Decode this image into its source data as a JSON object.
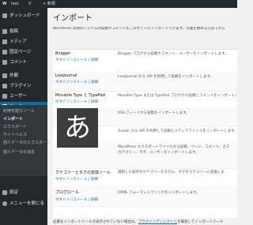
{
  "adminbar": {
    "wp_logo": "W",
    "home": "test",
    "comments": "0",
    "new": "+ 新規"
  },
  "menu": {
    "dashboard": "ダッシュボード",
    "posts": "投稿",
    "media": "メディア",
    "pages": "固定ページ",
    "comments": "コメント",
    "appearance": "外観",
    "plugins": "プラグイン",
    "users": "ユーザー",
    "tools": "ツール",
    "settings": "設定",
    "collapse": "メニューを閉じる",
    "submenu": [
      "利用可能なツール",
      "インポート",
      "エクスポート",
      "サイトヘルス",
      "個人データのエクスポート",
      "個人データの消去"
    ]
  },
  "page": {
    "title": "インポート",
    "intro": "WordPress は他のシステムの投稿やコメントをこのサイトにインポートできます。作業を始めるには下から"
  },
  "importers": [
    {
      "name": "Blogger",
      "action": "今すぐインストール | 詳細",
      "desc": "Blogger ブログから投稿やコメント、ユーザーをインポートします。"
    },
    {
      "name": "LiveJournal",
      "action": "今すぐインストール | 詳細",
      "desc": "LiveJournal から API を利用して投稿をインポートします。"
    },
    {
      "name": "Movable Type と TypePad",
      "action": "今すぐインストール | 詳細",
      "desc": "Movable Type または TypePad ブログから投稿とコメントをインポートします。"
    },
    {
      "name": "RSS",
      "action": "今すぐインストール | 詳細",
      "desc": "RSS フィードから投稿をインポートします。"
    },
    {
      "name": "Tumblr",
      "action": "今すぐインストール | 詳細",
      "desc": "Tumblr から API を利用して投稿とメディアファイルをインポートします。"
    },
    {
      "name": "WordPress",
      "action": "今すぐインストール | 詳細",
      "desc": "WordPress エクスポートファイルから投稿、ページ、コメント、カス"
    },
    {
      "name": "カテゴリーとタグの変換ツール",
      "action": "今すぐインストール | 詳細",
      "desc": "選択した既存のカテゴリーをタグに、タグをカテゴリーに変換しま"
    },
    {
      "name": "ブログロール",
      "action": "今すぐインストール | 詳細",
      "desc": "OPML フォーマットでリンクをインポートします。"
    }
  ],
  "extra_desc": "カテゴリー、タグ、ユーザーをインポートします。",
  "notice_prefix": "必要なインポートツールが表示されていない場合は、",
  "notice_link": "プラグインディレクトリ",
  "notice_suffix": "を検索してインポートツール",
  "tile_glyph": "あ"
}
